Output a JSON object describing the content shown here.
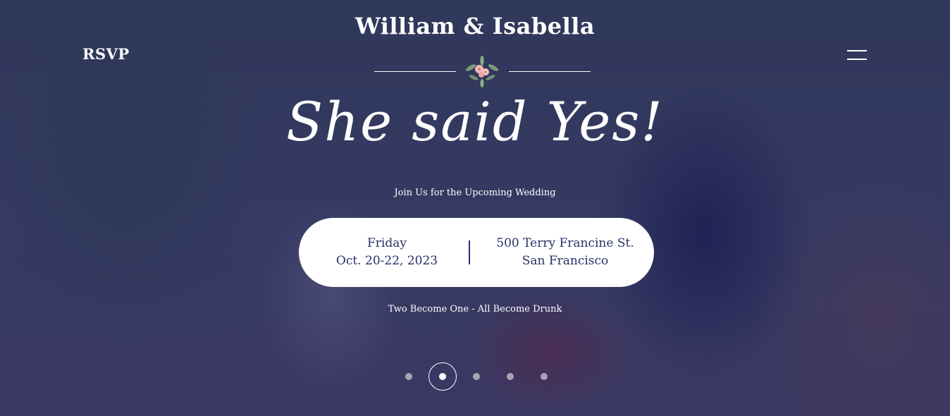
{
  "nav": {
    "rsvp_label": "RSVP",
    "menu_icon": "hamburger-menu-icon"
  },
  "hero": {
    "couple_names": "William & Isabella",
    "headline": "She said Yes!",
    "invite_text": "Join Us for the Upcoming Wedding",
    "event": {
      "day": "Friday",
      "date": "Oct. 20-22, 2023",
      "address": "500 Terry Francine St. San Francisco"
    },
    "tagline": "Two Become One - All Become Drunk"
  },
  "slider": {
    "count": 5,
    "active_index": 1
  },
  "colors": {
    "overlay": "#1e235f",
    "card_text": "#2a2f6a",
    "white": "#ffffff"
  }
}
